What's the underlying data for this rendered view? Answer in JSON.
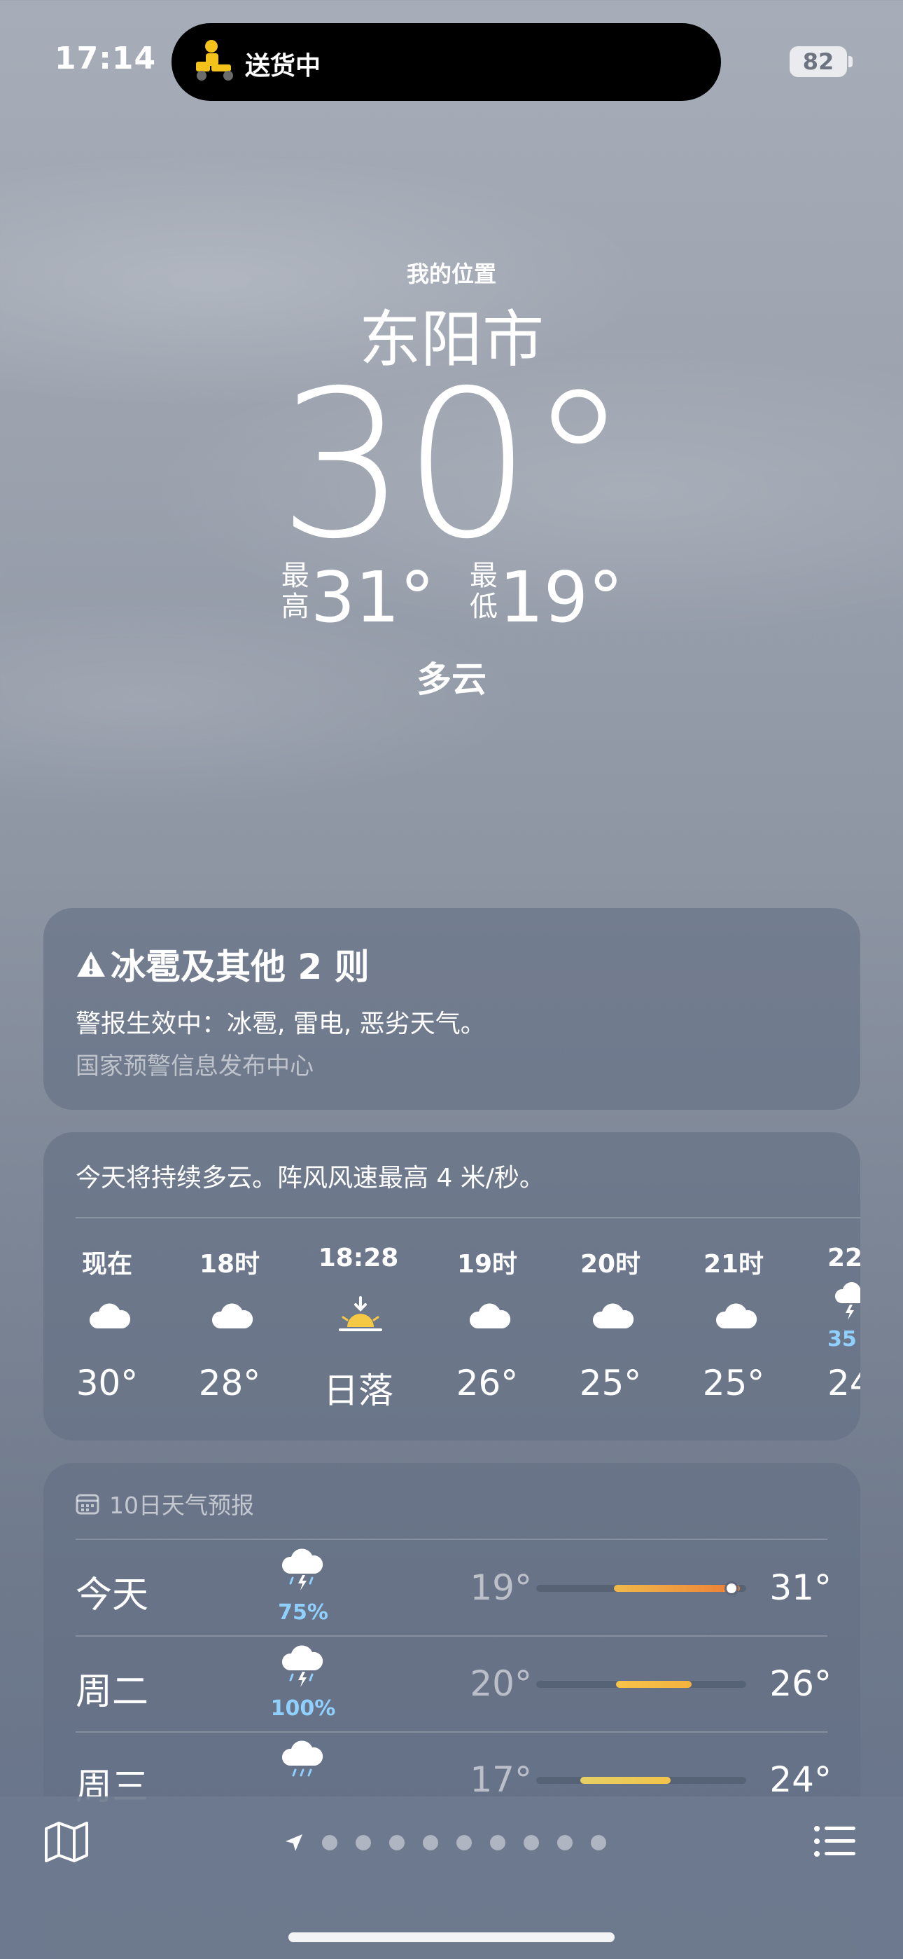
{
  "status_bar": {
    "time": "17:14",
    "live_activity": "送货中",
    "battery": "82"
  },
  "location": {
    "label": "我的位置",
    "city": "东阳市",
    "temperature": "30°",
    "high_label": "最高",
    "high": "31°",
    "low_label": "最低",
    "low": "19°",
    "condition": "多云"
  },
  "alert": {
    "title": "冰雹及其他 2 则",
    "body": "警报生效中：冰雹, 雷电, 恶劣天气。",
    "source": "国家预警信息发布中心"
  },
  "hourly": {
    "summary": "今天将持续多云。阵风风速最高 4 米/秒。",
    "items": [
      {
        "time": "现在",
        "icon": "cloud-icon",
        "temp": "30°"
      },
      {
        "time": "18时",
        "icon": "cloud-icon",
        "temp": "28°"
      },
      {
        "time": "18:28",
        "icon": "sunset-icon",
        "temp": "日落"
      },
      {
        "time": "19时",
        "icon": "cloud-icon",
        "temp": "26°"
      },
      {
        "time": "20时",
        "icon": "cloud-icon",
        "temp": "25°"
      },
      {
        "time": "21时",
        "icon": "cloud-icon",
        "temp": "25°"
      },
      {
        "time": "22",
        "icon": "thunderstorm-icon",
        "pct": "35",
        "temp": "24"
      }
    ]
  },
  "daily": {
    "header": "10日天气预报",
    "days": [
      {
        "name": "今天",
        "icon": "thunderstorm-icon",
        "pct": "75%",
        "low": "19°",
        "high": "31°",
        "range_start": 0.37,
        "range_end": 0.97,
        "current": 0.93,
        "colors": [
          "#f2b94a",
          "#ec7e36"
        ]
      },
      {
        "name": "周二",
        "icon": "thunderstorm-icon",
        "pct": "100%",
        "low": "20°",
        "high": "26°",
        "range_start": 0.38,
        "range_end": 0.74,
        "colors": [
          "#f7c34a",
          "#f3b33e"
        ]
      },
      {
        "name": "周三",
        "icon": "rain-icon",
        "pct": "",
        "low": "17°",
        "high": "24°",
        "range_start": 0.21,
        "range_end": 0.64,
        "colors": [
          "#e6d065",
          "#f2c44a"
        ]
      }
    ]
  },
  "toolbar": {
    "page_dots": 9
  }
}
